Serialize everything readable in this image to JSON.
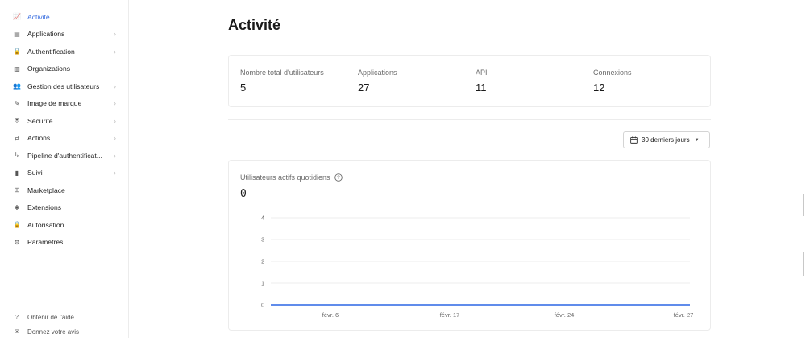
{
  "sidebar": {
    "items": [
      {
        "label": "Activité",
        "icon": "activity-chart-icon",
        "glyph": "📈",
        "active": true,
        "chevron": false
      },
      {
        "label": "Applications",
        "icon": "applications-icon",
        "glyph": "▤",
        "active": false,
        "chevron": true
      },
      {
        "label": "Authentification",
        "icon": "authentication-lock-icon",
        "glyph": "🔒",
        "active": false,
        "chevron": true
      },
      {
        "label": "Organizations",
        "icon": "organizations-icon",
        "glyph": "▥",
        "active": false,
        "chevron": false
      },
      {
        "label": "Gestion des utilisateurs",
        "icon": "users-icon",
        "glyph": "👥",
        "active": false,
        "chevron": true
      },
      {
        "label": "Image de marque",
        "icon": "branding-pen-icon",
        "glyph": "✎",
        "active": false,
        "chevron": true
      },
      {
        "label": "Sécurité",
        "icon": "security-shield-icon",
        "glyph": "⛨",
        "active": false,
        "chevron": true
      },
      {
        "label": "Actions",
        "icon": "actions-icon",
        "glyph": "⇄",
        "active": false,
        "chevron": true
      },
      {
        "label": "Pipeline d'authentificat...",
        "icon": "pipeline-icon",
        "glyph": "↳",
        "active": false,
        "chevron": true
      },
      {
        "label": "Suivi",
        "icon": "monitoring-bars-icon",
        "glyph": "▮",
        "active": false,
        "chevron": true
      },
      {
        "label": "Marketplace",
        "icon": "marketplace-grid-icon",
        "glyph": "⊞",
        "active": false,
        "chevron": false
      },
      {
        "label": "Extensions",
        "icon": "extensions-icon",
        "glyph": "✱",
        "active": false,
        "chevron": false
      },
      {
        "label": "Autorisation",
        "icon": "authorization-lock-icon",
        "glyph": "🔒",
        "active": false,
        "chevron": false
      },
      {
        "label": "Paramètres",
        "icon": "settings-gear-icon",
        "glyph": "⚙",
        "active": false,
        "chevron": false
      }
    ],
    "footer": [
      {
        "label": "Obtenir de l'aide",
        "icon": "help-circle-icon",
        "glyph": "?"
      },
      {
        "label": "Donnez votre avis",
        "icon": "feedback-icon",
        "glyph": "✉"
      }
    ],
    "chevron_glyph": "›"
  },
  "page": {
    "title": "Activité"
  },
  "stats": [
    {
      "label": "Nombre total d'utilisateurs",
      "value": "5"
    },
    {
      "label": "Applications",
      "value": "27"
    },
    {
      "label": "API",
      "value": "11"
    },
    {
      "label": "Connexions",
      "value": "12"
    }
  ],
  "date_range": {
    "label": "30 derniers jours",
    "caret": "▼"
  },
  "chart": {
    "title": "Utilisateurs actifs quotidiens",
    "value": "0"
  },
  "chart_data": {
    "type": "line",
    "title": "Utilisateurs actifs quotidiens",
    "xlabel": "",
    "ylabel": "",
    "x_tick_labels": [
      "févr. 6",
      "févr. 17",
      "févr. 24",
      "févr. 27"
    ],
    "y_ticks": [
      0,
      1,
      2,
      3,
      4
    ],
    "ylim": [
      0,
      4
    ],
    "series": [
      {
        "values": [
          0,
          0,
          0,
          0
        ]
      }
    ],
    "grid": true,
    "line_color": "#4a7be8"
  },
  "colors": {
    "accent": "#3a6fe0",
    "line": "#4a7be8",
    "border": "#ececec"
  }
}
